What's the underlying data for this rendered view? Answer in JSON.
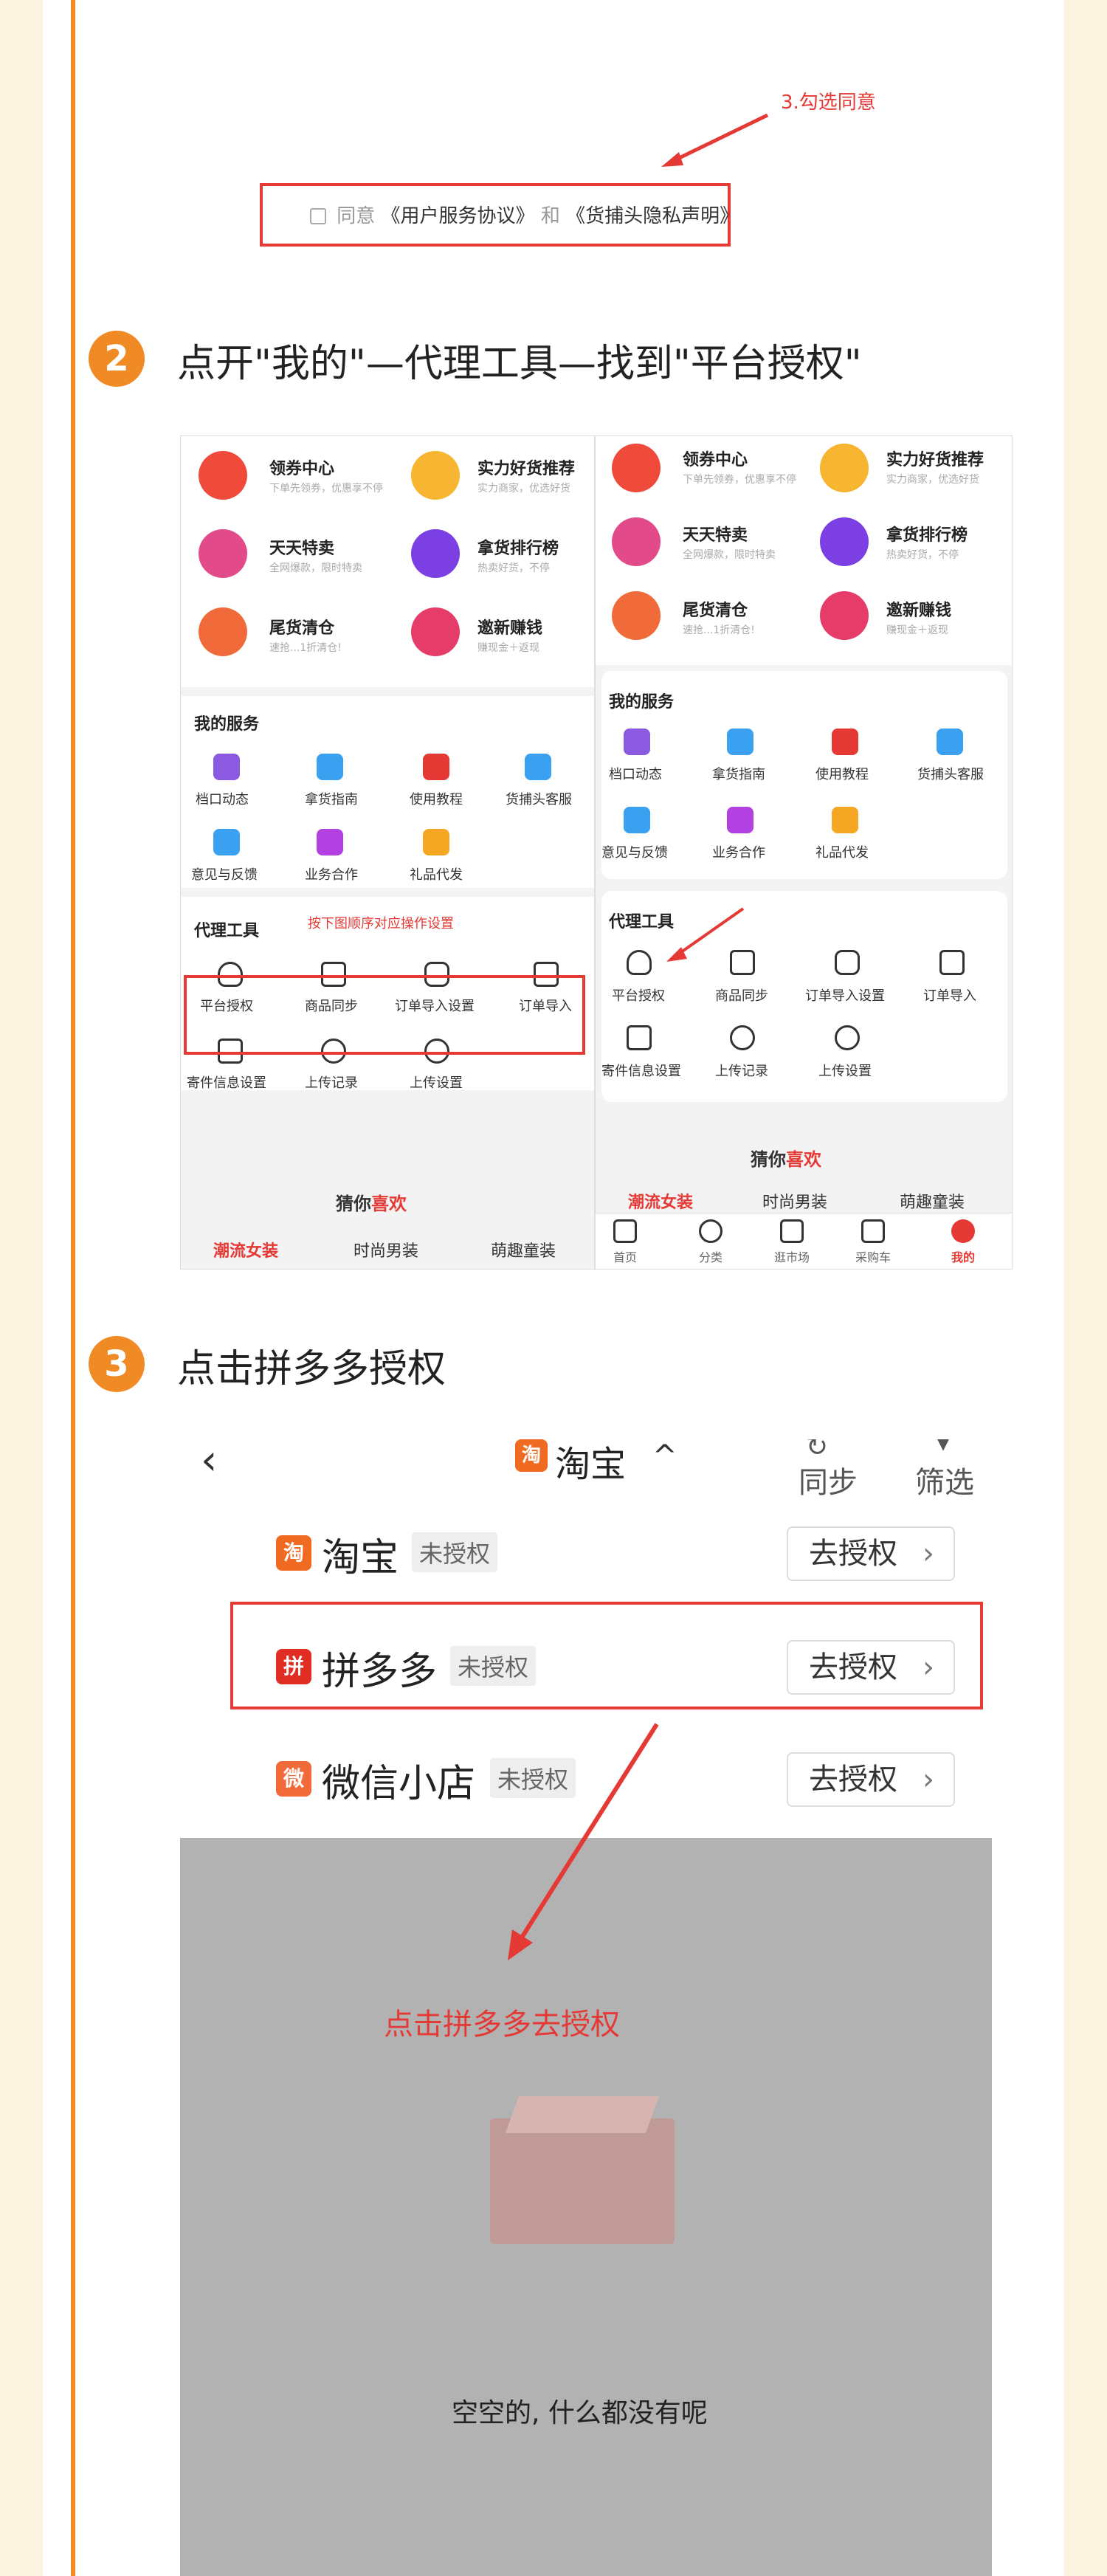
{
  "colors": {
    "accent": "#f08a24",
    "alert": "#e53935",
    "background": "#fdf3e1"
  },
  "step1": {
    "annotation": "3.勾选同意",
    "agreement_prefix": "同意",
    "agreement_link1": "《用户服务协议》",
    "agreement_and": "和",
    "agreement_link2": "《货捕头隐私声明》"
  },
  "step2": {
    "badge": "2",
    "title": "点开\"我的\"—代理工具—找到\"平台授权\"",
    "left": {
      "promos": [
        {
          "title": "领券中心",
          "sub": "下单先领券，优惠享不停",
          "icon": "ticket-icon",
          "color": "#f04a3a"
        },
        {
          "title": "实力好货推荐",
          "sub": "实力商家，优选好货",
          "icon": "gift-icon",
          "color": "#f7b531"
        },
        {
          "title": "天天特卖",
          "sub": "全网爆款，限时特卖",
          "icon": "sale-icon",
          "color": "#e34a8a"
        },
        {
          "title": "拿货排行榜",
          "sub": "热卖好货，不停",
          "icon": "trophy-icon",
          "color": "#7b3fe4"
        },
        {
          "title": "尾货清仓",
          "sub": "速抢...1折清仓!",
          "icon": "clearance-icon",
          "color": "#f06a3a"
        },
        {
          "title": "邀新赚钱",
          "sub": "赚现金＋返现",
          "icon": "invite-icon",
          "color": "#e53c6a"
        }
      ],
      "services_title": "我的服务",
      "services": [
        "档口动态",
        "拿货指南",
        "使用教程",
        "货捕头客服",
        "意见与反馈",
        "业务合作",
        "礼品代发"
      ],
      "agent_title": "代理工具",
      "agent_note": "按下图顺序对应操作设置",
      "agent_tools": [
        "平台授权",
        "商品同步",
        "订单导入设置",
        "订单导入",
        "寄件信息设置",
        "上传记录",
        "上传设置"
      ],
      "guess_title_a": "猜你",
      "guess_title_b": "喜欢",
      "tabs": [
        "潮流女装",
        "时尚男装",
        "萌趣童装"
      ]
    },
    "right": {
      "promos": [
        {
          "title": "领券中心",
          "sub": "下单先领券，优惠享不停"
        },
        {
          "title": "实力好货推荐",
          "sub": "实力商家，优选好货"
        },
        {
          "title": "天天特卖",
          "sub": "全网爆款，限时特卖"
        },
        {
          "title": "拿货排行榜",
          "sub": "热卖好货，不停"
        },
        {
          "title": "尾货清仓",
          "sub": "速抢...1折清仓!"
        },
        {
          "title": "邀新赚钱",
          "sub": "赚现金＋返现"
        }
      ],
      "services_title": "我的服务",
      "services": [
        "档口动态",
        "拿货指南",
        "使用教程",
        "货捕头客服",
        "意见与反馈",
        "业务合作",
        "礼品代发"
      ],
      "agent_title": "代理工具",
      "agent_tools": [
        "平台授权",
        "商品同步",
        "订单导入设置",
        "订单导入",
        "寄件信息设置",
        "上传记录",
        "上传设置"
      ],
      "guess_title_a": "猜你",
      "guess_title_b": "喜欢",
      "tabs": [
        "潮流女装",
        "时尚男装",
        "萌趣童装"
      ],
      "bottom_nav": [
        "首页",
        "分类",
        "逛市场",
        "采购车",
        "我的"
      ]
    }
  },
  "step3": {
    "badge": "3",
    "title": "点击拼多多授权",
    "header_title": "淘宝",
    "header_sync": "同步",
    "header_filter": "筛选",
    "platforms": [
      {
        "name": "淘宝",
        "status": "未授权",
        "action": "去授权",
        "icon_char": "淘",
        "color": "#f06a22"
      },
      {
        "name": "拼多多",
        "status": "未授权",
        "action": "去授权",
        "icon_char": "拼",
        "color": "#e02e24"
      },
      {
        "name": "微信小店",
        "status": "未授权",
        "action": "去授权",
        "icon_char": "微",
        "color": "#f26a3a"
      }
    ],
    "annotation": "点击拼多多去授权",
    "empty_text": "空空的, 什么都没有呢"
  }
}
